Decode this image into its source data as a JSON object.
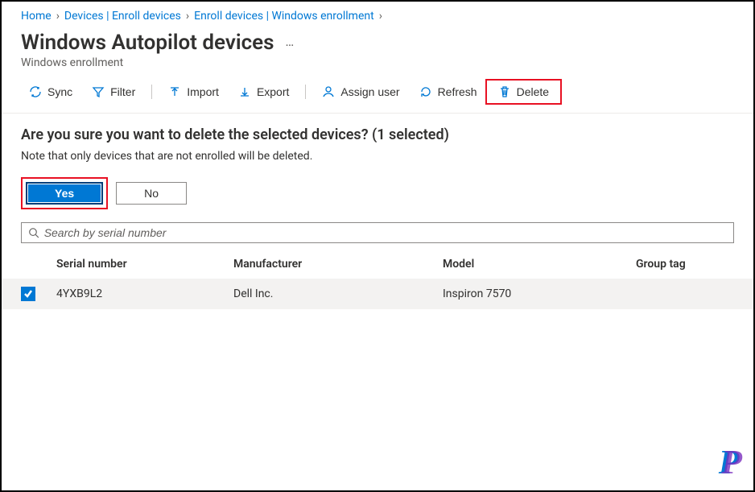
{
  "breadcrumb": {
    "home": "Home",
    "devices": "Devices | Enroll devices",
    "enrollment": "Enroll devices | Windows enrollment"
  },
  "header": {
    "title": "Windows Autopilot devices",
    "subtitle": "Windows enrollment",
    "ellipsis": "…"
  },
  "toolbar": {
    "sync": "Sync",
    "filter": "Filter",
    "import": "Import",
    "export": "Export",
    "assign_user": "Assign user",
    "refresh": "Refresh",
    "delete": "Delete"
  },
  "confirm": {
    "title": "Are you sure you want to delete the selected devices? (1 selected)",
    "note": "Note that only devices that are not enrolled will be deleted.",
    "yes": "Yes",
    "no": "No"
  },
  "search": {
    "placeholder": "Search by serial number"
  },
  "table": {
    "headers": {
      "serial": "Serial number",
      "manufacturer": "Manufacturer",
      "model": "Model",
      "group_tag": "Group tag"
    },
    "rows": [
      {
        "serial": "4YXB9L2",
        "manufacturer": "Dell Inc.",
        "model": "Inspiron 7570",
        "group_tag": ""
      }
    ]
  }
}
